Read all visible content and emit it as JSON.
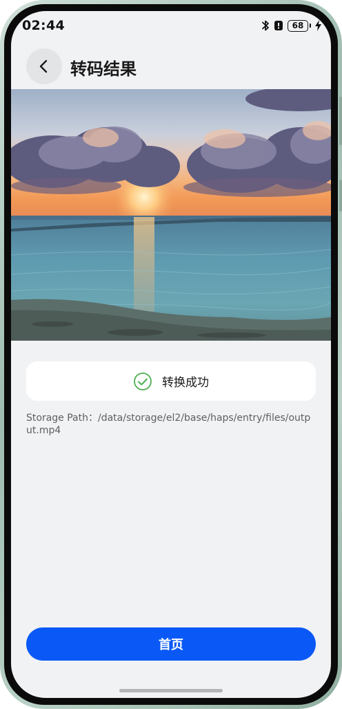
{
  "status_bar": {
    "time": "02:44",
    "battery_level": "68",
    "icons": [
      "bluetooth-icon",
      "notification-icon",
      "battery-icon",
      "charging-icon"
    ]
  },
  "header": {
    "title": "转码结果",
    "back_icon": "chevron-left-icon"
  },
  "preview": {
    "icon": "video-thumbnail"
  },
  "result": {
    "status_text": "转换成功",
    "status_icon": "check-circle-icon",
    "status_color": "#4caf50"
  },
  "storage": {
    "path_text": "Storage Path：/data/storage/el2/base/haps/entry/files/output.mp4"
  },
  "actions": {
    "home_label": "首页"
  },
  "colors": {
    "accent": "#0a59f7",
    "background": "#f1f2f4",
    "success": "#4caf50"
  }
}
